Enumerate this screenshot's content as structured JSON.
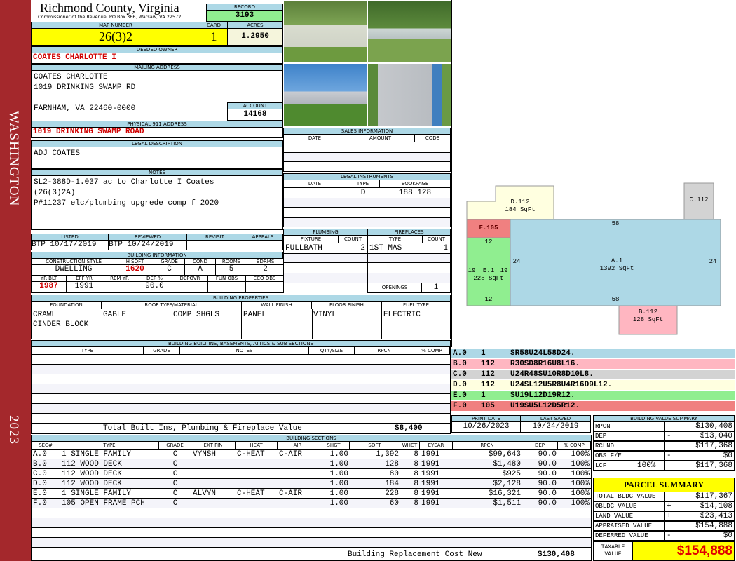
{
  "side": {
    "district": "WASHINGTON",
    "year": "2023"
  },
  "header": {
    "county": "Richmond County, Virginia",
    "office": "Commissioner of the Revenue, PO Box 366, Warsaw, VA 22572",
    "record_label": "RECORD",
    "record": "3193",
    "map_label": "MAP NUMBER",
    "map": "26(3)2",
    "card_label": "CARD",
    "card": "1",
    "acres_label": "ACRES",
    "acres": "1.2950"
  },
  "owner": {
    "label": "DEEDED OWNER",
    "name": "COATES CHARLOTTE I"
  },
  "mailing": {
    "label": "MAILING ADDRESS",
    "line1": "COATES CHARLOTTE",
    "line2": "1019 DRINKING SWAMP RD",
    "line3": "FARNHAM, VA 22460-0000",
    "account_label": "ACCOUNT",
    "account": "14168"
  },
  "physical": {
    "label": "PHYSICAL 911 ADDRESS",
    "address": "1019 DRINKING SWAMP ROAD"
  },
  "legal": {
    "label": "LEGAL DESCRIPTION",
    "text": "ADJ COATES"
  },
  "notes": {
    "label": "NOTES",
    "lines": [
      "SL2-388D-1.037 ac to Charlotte I Coates",
      "(26(3)2A)",
      "P#11237 elc/plumbing upgrede comp f 2020"
    ]
  },
  "sales": {
    "label": "SALES INFORMATION",
    "cols": [
      "DATE",
      "AMOUNT",
      "CODE"
    ]
  },
  "instruments": {
    "label": "LEGAL INSTRUMENTS",
    "cols": [
      "DATE",
      "TYPE",
      "BOOKPAGE"
    ],
    "rows": [
      {
        "date": "",
        "type": "D",
        "bookpage": "188 128"
      }
    ]
  },
  "listing": {
    "cols": [
      "LISTED",
      "REVIEWED",
      "REVISIT",
      "APPEALS"
    ],
    "values": [
      "BTP 10/17/2019",
      "BTP 10/24/2019",
      "",
      ""
    ]
  },
  "building_info": {
    "label": "BUILDING INFORMATION",
    "cols1": [
      "CONSTRUCTION STYLE",
      "H SQFT",
      "GRADE",
      "COND",
      "ROOMS",
      "BDRMS"
    ],
    "vals1": [
      "DWELLING",
      "1620",
      "C",
      "A",
      "5",
      "2"
    ],
    "cols2": [
      "YR BLT",
      "EFF YR",
      "REM YR",
      "DEP %",
      "DEPOVR",
      "FUN OBS",
      "ECO OBS"
    ],
    "vals2": [
      "1987",
      "1991",
      "",
      "90.0",
      "",
      "",
      ""
    ]
  },
  "plumbing": {
    "label": "PLUMBING",
    "cols": [
      "FIXTURE",
      "COUNT"
    ],
    "fixture": "FULLBATH",
    "count": "2"
  },
  "fireplaces": {
    "label": "FIREPLACES",
    "cols": [
      "TYPE",
      "COUNT"
    ],
    "type": "1ST MAS",
    "count": "1",
    "openings_label": "OPENINGS",
    "openings": "1"
  },
  "properties": {
    "label": "BUILDING PROPERTIES",
    "cols": [
      "FOUNDATION",
      "ROOF TYPE/MATERIAL",
      "WALL FINISH",
      "FLOOR FINISH",
      "FUEL TYPE"
    ],
    "foundation": [
      "CRAWL",
      "CINDER BLOCK"
    ],
    "roof_type": "GABLE",
    "roof_material": "COMP SHGLS",
    "wall": "PANEL",
    "floor": "VINYL",
    "fuel": "ELECTRIC"
  },
  "builtins": {
    "label": "BUILDING BUILT INS, BASEMENTS, ATTICS & SUB SECTIONS",
    "cols": [
      "TYPE",
      "GRADE",
      "NOTES",
      "QTY/SIZE",
      "RPCN",
      "% COMP"
    ],
    "total_label": "Total Built Ins, Plumbing & Fireplace Value",
    "total": "$8,400"
  },
  "sketch": {
    "shapes": [
      {
        "id": "D.112",
        "area": "184 SqFt",
        "color": "#ffffe0"
      },
      {
        "id": "C.112",
        "area": "",
        "color": "#d3d3d3"
      },
      {
        "id": "F.105",
        "area": "",
        "color": "#f08080"
      },
      {
        "id": "A.1",
        "area": "1392 SqFt",
        "color": "#add8e6"
      },
      {
        "id": "E.1",
        "area": "228 SqFt",
        "color": "#90ee90"
      },
      {
        "id": "B.112",
        "area": "128 SqFt",
        "color": "#ffb6c1"
      }
    ],
    "dims": {
      "a_top": "58",
      "a_bottom": "58",
      "a_left": "24",
      "a_right": "24",
      "e_top": "12",
      "e_bottom": "12",
      "e_left": "19",
      "e_right": "19"
    }
  },
  "sketch_records": [
    {
      "sec": "A.0",
      "code": "1",
      "path": "SR58U24L58D24.",
      "color": "#add8e6"
    },
    {
      "sec": "B.0",
      "code": "112",
      "path": "R30SD8R16U8L16.",
      "color": "#ffb6c1"
    },
    {
      "sec": "C.0",
      "code": "112",
      "path": "U24R48SU10R8D10L8.",
      "color": "#d3d3d3"
    },
    {
      "sec": "D.0",
      "code": "112",
      "path": "U24SL12U5R8U4R16D9L12.",
      "color": "#ffffe0"
    },
    {
      "sec": "E.0",
      "code": "1",
      "path": "SU19L12D19R12.",
      "color": "#90ee90"
    },
    {
      "sec": "F.0",
      "code": "105",
      "path": "U19SU5L12D5R12.",
      "color": "#f08080"
    }
  ],
  "dates": {
    "print_label": "PRINT DATE",
    "print": "10/26/2023",
    "saved_label": "LAST SAVED",
    "saved": "10/24/2019"
  },
  "value_summary": {
    "label": "BUILDING VALUE SUMMARY",
    "rows": [
      {
        "label": "RPCN",
        "sign": "",
        "value": "$130,408"
      },
      {
        "label": "DEP",
        "sign": "-",
        "value": "$13,040"
      },
      {
        "label": "RCLND",
        "sign": "",
        "value": "$117,368"
      },
      {
        "label": "OBS F/E",
        "sign": "-",
        "value": "$0"
      },
      {
        "label": "LCF",
        "sign": "100%",
        "value": "$117,368"
      }
    ]
  },
  "parcel_summary": {
    "label": "PARCEL SUMMARY",
    "rows": [
      {
        "label": "TOTAL BLDG VALUE",
        "sign": "",
        "value": "$117,367"
      },
      {
        "label": "OBLDG VALUE",
        "sign": "+",
        "value": "$14,108"
      },
      {
        "label": "LAND VALUE",
        "sign": "+",
        "value": "$23,413"
      },
      {
        "label": "APPRAISED VALUE",
        "sign": "",
        "value": "$154,888"
      },
      {
        "label": "DEFERRED VALUE",
        "sign": "-",
        "value": "$0"
      }
    ],
    "taxable_label": "TAXABLE VALUE",
    "taxable": "$154,888"
  },
  "sections": {
    "label": "BUILDING SECTIONS",
    "cols": [
      "SEC#",
      "TYPE",
      "GRADE",
      "EXT FIN",
      "HEAT",
      "AIR",
      "SHGT",
      "SQFT",
      "WHGT",
      "EYEAR",
      "RPCN",
      "DEP",
      "% COMP"
    ],
    "rows": [
      [
        "A.0",
        "1 SINGLE FAMILY",
        "C",
        "VYNSH",
        "C-HEAT",
        "C-AIR",
        "1.00",
        "1,392",
        "8",
        "1991",
        "$99,643",
        "90.0",
        "100%"
      ],
      [
        "B.0",
        "112 WOOD DECK",
        "C",
        "",
        "",
        "",
        "1.00",
        "128",
        "8",
        "1991",
        "$1,480",
        "90.0",
        "100%"
      ],
      [
        "C.0",
        "112 WOOD DECK",
        "C",
        "",
        "",
        "",
        "1.00",
        "80",
        "8",
        "1991",
        "$925",
        "90.0",
        "100%"
      ],
      [
        "D.0",
        "112 WOOD DECK",
        "C",
        "",
        "",
        "",
        "1.00",
        "184",
        "8",
        "1991",
        "$2,128",
        "90.0",
        "100%"
      ],
      [
        "E.0",
        "1 SINGLE FAMILY",
        "C",
        "ALVYN",
        "C-HEAT",
        "C-AIR",
        "1.00",
        "228",
        "8",
        "1991",
        "$16,321",
        "90.0",
        "100%"
      ],
      [
        "F.0",
        "105 OPEN FRAME PCH",
        "C",
        "",
        "",
        "",
        "1.00",
        "60",
        "8",
        "1991",
        "$1,511",
        "90.0",
        "100%"
      ]
    ],
    "total_label": "Building Replacement Cost New",
    "total": "$130,408"
  }
}
